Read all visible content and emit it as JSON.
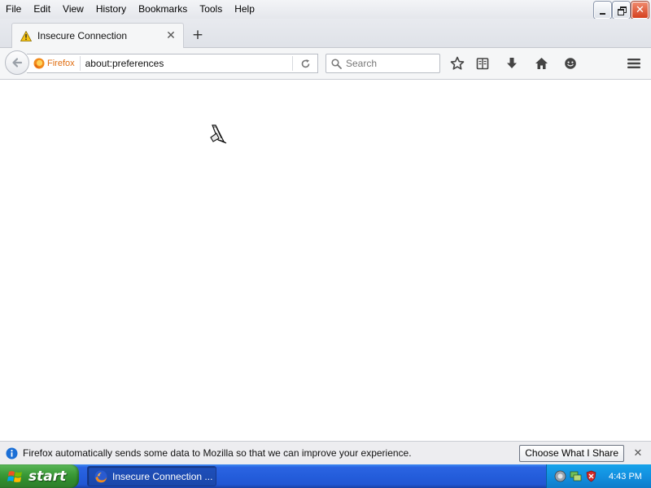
{
  "menubar": {
    "items": [
      {
        "label": "File"
      },
      {
        "label": "Edit"
      },
      {
        "label": "View"
      },
      {
        "label": "History"
      },
      {
        "label": "Bookmarks"
      },
      {
        "label": "Tools"
      },
      {
        "label": "Help"
      }
    ]
  },
  "window_controls": {
    "minimize_icon": "minimize-icon",
    "restore_icon": "restore-icon",
    "close_icon": "close-icon",
    "close_glyph": "✕"
  },
  "tabs": [
    {
      "title": "Insecure Connection",
      "icon": "warning-icon",
      "active": true
    }
  ],
  "tab_close_glyph": "✕",
  "new_tab_glyph": "+",
  "navbar": {
    "identity_label": "Firefox",
    "url": "about:preferences",
    "search_placeholder": "Search",
    "toolbar_icons": [
      "bookmark-star-icon",
      "reading-list-icon",
      "downloads-icon",
      "home-icon",
      "hello-icon",
      "menu-icon"
    ]
  },
  "notification": {
    "message": "Firefox automatically sends some data to Mozilla so that we can improve your experience.",
    "button_label": "Choose What I Share",
    "close_glyph": "✕"
  },
  "taskbar": {
    "start_label": "start",
    "task_label": "Insecure Connection ...",
    "clock": "4:43 PM"
  },
  "colors": {
    "firefox_orange": "#e06d10",
    "taskbar_blue": "#245ddb",
    "start_green": "#3c9b39",
    "tray_blue": "#1290e0",
    "warning_yellow": "#f5c211"
  }
}
